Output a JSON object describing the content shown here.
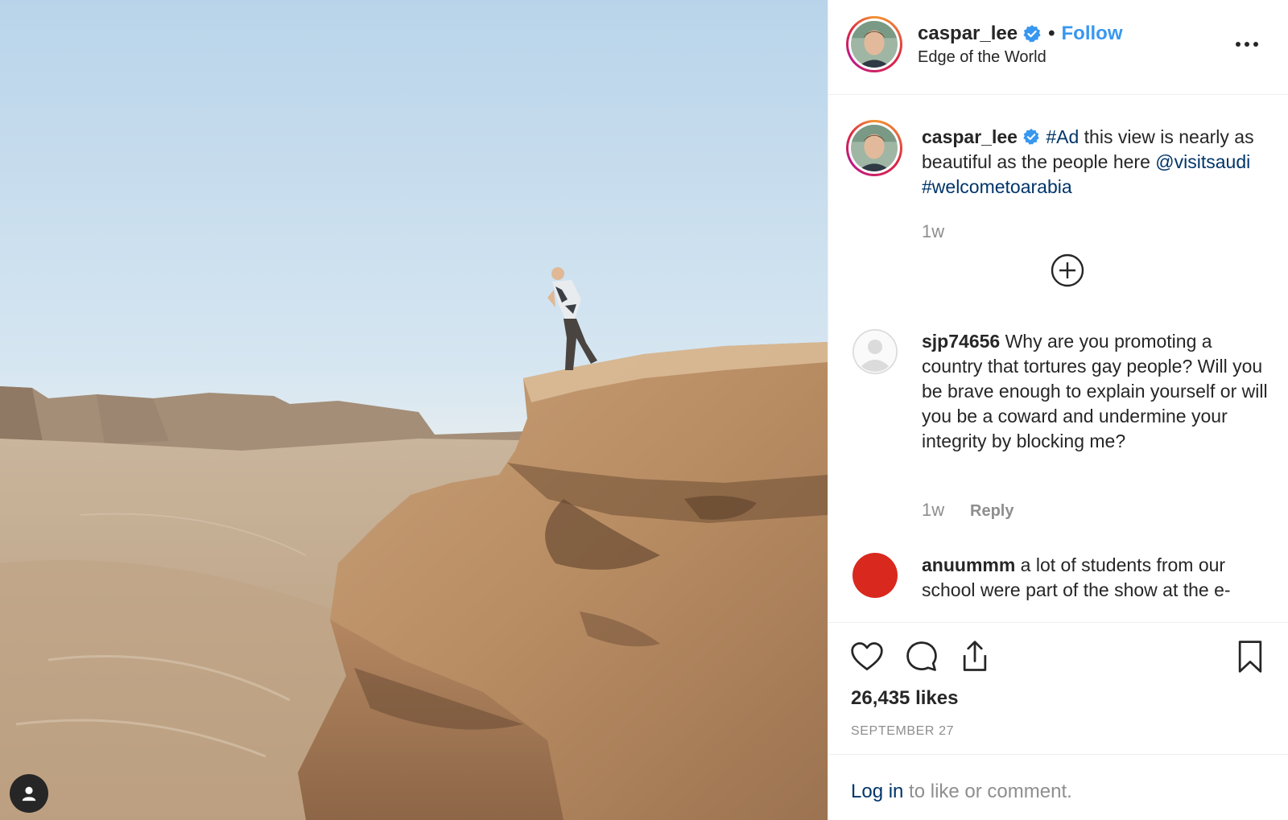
{
  "header": {
    "username": "caspar_lee",
    "separator": "•",
    "follow_label": "Follow",
    "location": "Edge of the World",
    "more_icon": "more-horizontal-icon"
  },
  "caption": {
    "username": "caspar_lee",
    "text_part1": " ",
    "hashtag_ad": "#Ad",
    "text_part2": " this view is nearly as beautiful as the people here ",
    "mention": "@visitsaudi",
    "text_part3": " ",
    "hashtag": "#welcometoarabia",
    "time": "1w"
  },
  "comments": [
    {
      "username": "sjp74656",
      "text": " Why are you promoting a country that tortures gay people? Will you be brave enough to explain yourself or will you be a coward and undermine your integrity by blocking me?",
      "time": "1w",
      "reply_label": "Reply"
    },
    {
      "username": "anuummm",
      "text": " a lot of students from our school were part of the show at the e-"
    }
  ],
  "actions": {
    "likes": "26,435 likes",
    "date": "SEPTEMBER 27"
  },
  "login": {
    "link": "Log in",
    "rest": " to like or comment."
  },
  "colors": {
    "accent": "#3897f0",
    "link": "#003569",
    "muted": "#8e8e8e",
    "text": "#262626",
    "red_avatar": "#d9281d"
  }
}
